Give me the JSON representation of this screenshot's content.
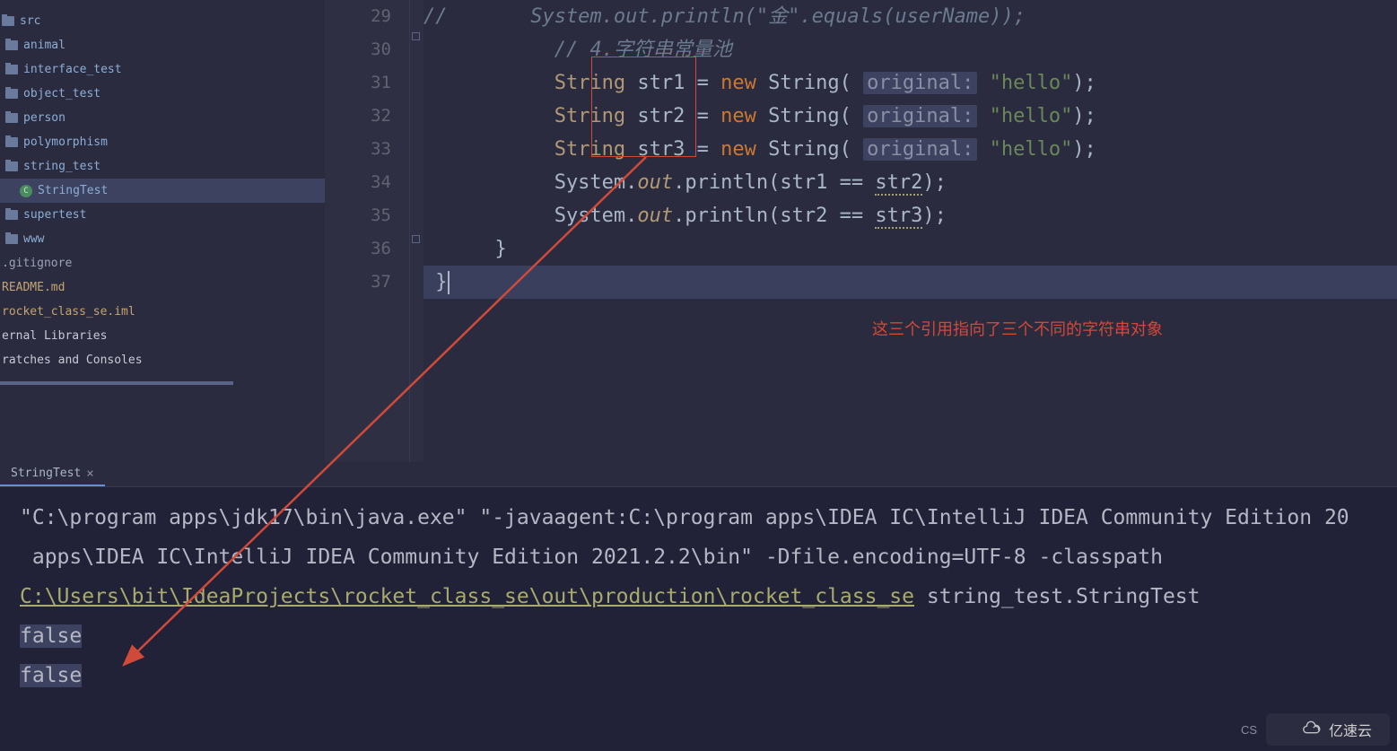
{
  "sidebar": {
    "items": [
      {
        "label": "src",
        "icon": "folder",
        "depth": 0,
        "style": "label"
      },
      {
        "label": "animal",
        "icon": "folder",
        "depth": 1,
        "style": "label"
      },
      {
        "label": "interface_test",
        "icon": "folder",
        "depth": 1,
        "style": "label"
      },
      {
        "label": "object_test",
        "icon": "folder",
        "depth": 1,
        "style": "label"
      },
      {
        "label": "person",
        "icon": "folder",
        "depth": 1,
        "style": "label"
      },
      {
        "label": "polymorphism",
        "icon": "folder",
        "depth": 1,
        "style": "label"
      },
      {
        "label": "string_test",
        "icon": "folder",
        "depth": 1,
        "style": "label"
      },
      {
        "label": "StringTest",
        "icon": "class",
        "depth": 2,
        "style": "label",
        "selected": true
      },
      {
        "label": "supertest",
        "icon": "folder",
        "depth": 1,
        "style": "label"
      },
      {
        "label": "www",
        "icon": "folder",
        "depth": 1,
        "style": "label"
      },
      {
        "label": ".gitignore",
        "icon": "none",
        "depth": 0,
        "style": "muted"
      },
      {
        "label": "README.md",
        "icon": "none",
        "depth": 0,
        "style": "hl"
      },
      {
        "label": "rocket_class_se.iml",
        "icon": "none",
        "depth": 0,
        "style": "hl"
      },
      {
        "label": "ernal Libraries",
        "icon": "lib",
        "depth": 0,
        "style": "white"
      },
      {
        "label": "ratches and Consoles",
        "icon": "none",
        "depth": 0,
        "style": "white"
      }
    ]
  },
  "editor": {
    "line_start": 29,
    "annotation": "这三个引用指向了三个不同的字符串对象",
    "param_hint": "original:",
    "code_text": {
      "l29": "//       System.out.println(\"金\".equals(userName));",
      "l30": "// 4.字符串常量池",
      "l31_a": "String str1 = new String(",
      "l31_b": "\"hello\");",
      "l32_a": "String str2 = new String(",
      "l32_b": "\"hello\");",
      "l33_a": "String str3 = new String(",
      "l33_b": "\"hello\");",
      "l34": "System.out.println(str1 == str2);",
      "l35": "System.out.println(str2 == str3);",
      "l36": "}",
      "l37": "}"
    }
  },
  "tab": {
    "label": "StringTest"
  },
  "console": {
    "line1": "\"C:\\program apps\\jdk17\\bin\\java.exe\" \"-javaagent:C:\\program apps\\IDEA IC\\IntelliJ IDEA Community Edition 20",
    "line2": " apps\\IDEA IC\\IntelliJ IDEA Community Edition 2021.2.2\\bin\" -Dfile.encoding=UTF-8 -classpath ",
    "line3_link": "C:\\Users\\bit\\IdeaProjects\\rocket_class_se\\out\\production\\rocket_class_se",
    "line3_rest": " string_test.StringTest",
    "out1": "false",
    "out2": "false"
  },
  "watermark": {
    "text": "亿速云",
    "corner": "CS"
  }
}
